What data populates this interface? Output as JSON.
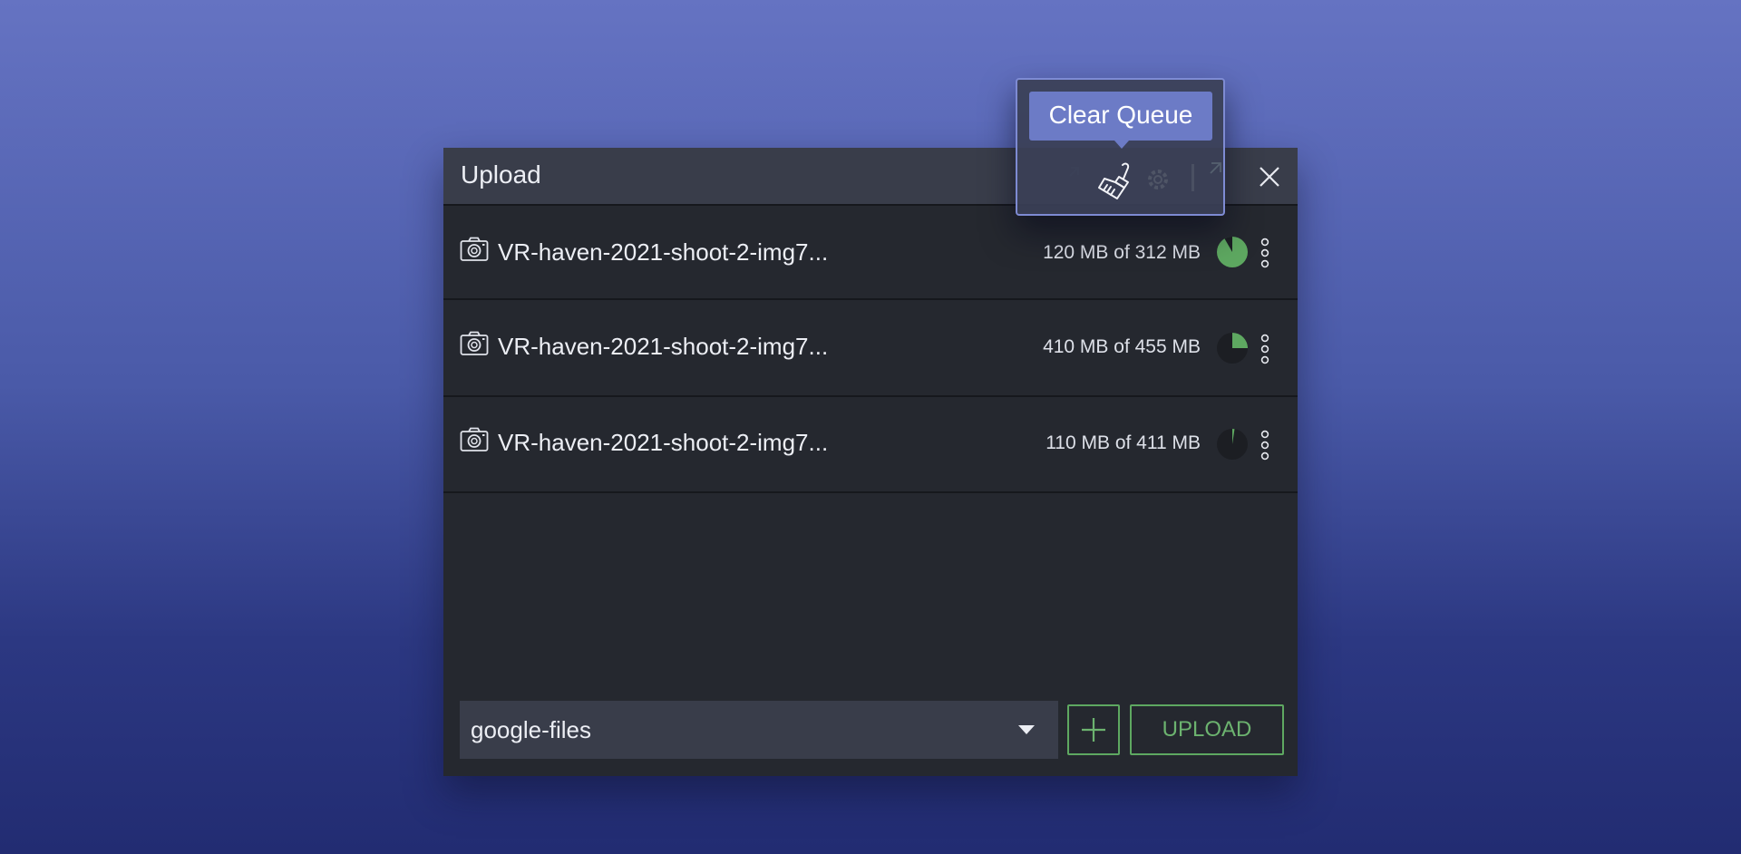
{
  "window": {
    "title": "Upload"
  },
  "tooltip": {
    "text": "Clear Queue"
  },
  "toolbar": {
    "icons": [
      "broom-icon",
      "gear-icon",
      "separator",
      "expand-icon",
      "close-icon"
    ]
  },
  "files": [
    {
      "name": "VR-haven-2021-shoot-2-img7...",
      "size_text": "120 MB of 312 MB",
      "progress": 0.82,
      "status": "complete-color"
    },
    {
      "name": "VR-haven-2021-shoot-2-img7...",
      "size_text": "410 MB of 455 MB",
      "progress": 0.25,
      "status": "in-progress"
    },
    {
      "name": "VR-haven-2021-shoot-2-img7...",
      "size_text": "110 MB of 411 MB",
      "progress": 0.02,
      "status": "in-progress"
    }
  ],
  "footer": {
    "destination": "google-files",
    "upload_label": "UPLOAD",
    "add_icon": "plus-icon"
  },
  "colors": {
    "accent_green": "#5ea861",
    "tooltip_bg": "#6c7bc6",
    "panel_bg": "#25282f",
    "header_bg": "#393d4a"
  }
}
